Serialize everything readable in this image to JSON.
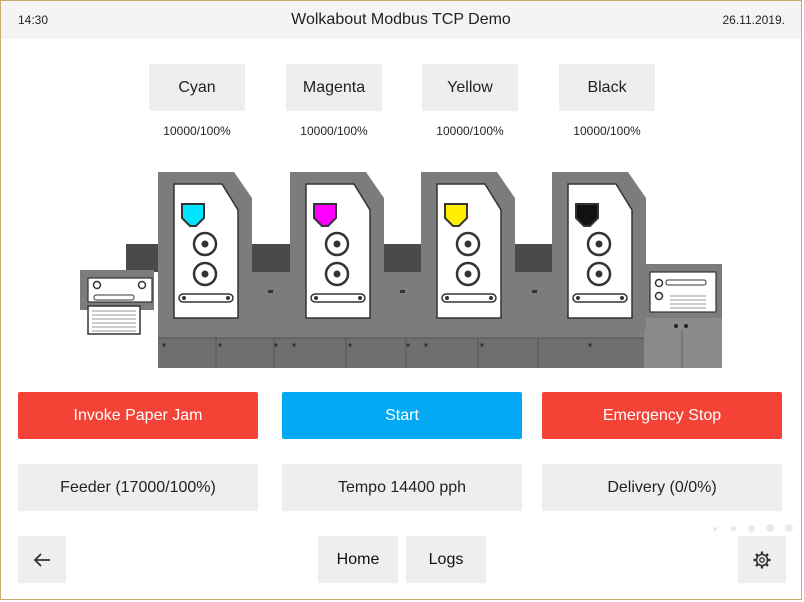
{
  "status_bar": {
    "time": "14:30",
    "title": "Wolkabout Modbus TCP Demo",
    "date": "26.11.2019."
  },
  "inks": [
    {
      "label": "Cyan",
      "level": "10000/100%",
      "color": "#00e5ff"
    },
    {
      "label": "Magenta",
      "level": "10000/100%",
      "color": "#ff00ff"
    },
    {
      "label": "Yellow",
      "level": "10000/100%",
      "color": "#ffee00"
    },
    {
      "label": "Black",
      "level": "10000/100%",
      "color": "#111111"
    }
  ],
  "actions": {
    "paper_jam": "Invoke Paper Jam",
    "start": "Start",
    "emergency_stop": "Emergency Stop"
  },
  "info": {
    "feeder": "Feeder (17000/100%)",
    "tempo": "Tempo 14400 pph",
    "delivery": "Delivery (0/0%)"
  },
  "nav": {
    "home": "Home",
    "logs": "Logs"
  },
  "colors": {
    "danger": "#f44336",
    "primary": "#03a9f4",
    "button_bg": "#eeeeee",
    "machine_gray": "#7c7c7c"
  },
  "icons": {
    "back": "arrow-left-icon",
    "settings": "gear-icon"
  }
}
